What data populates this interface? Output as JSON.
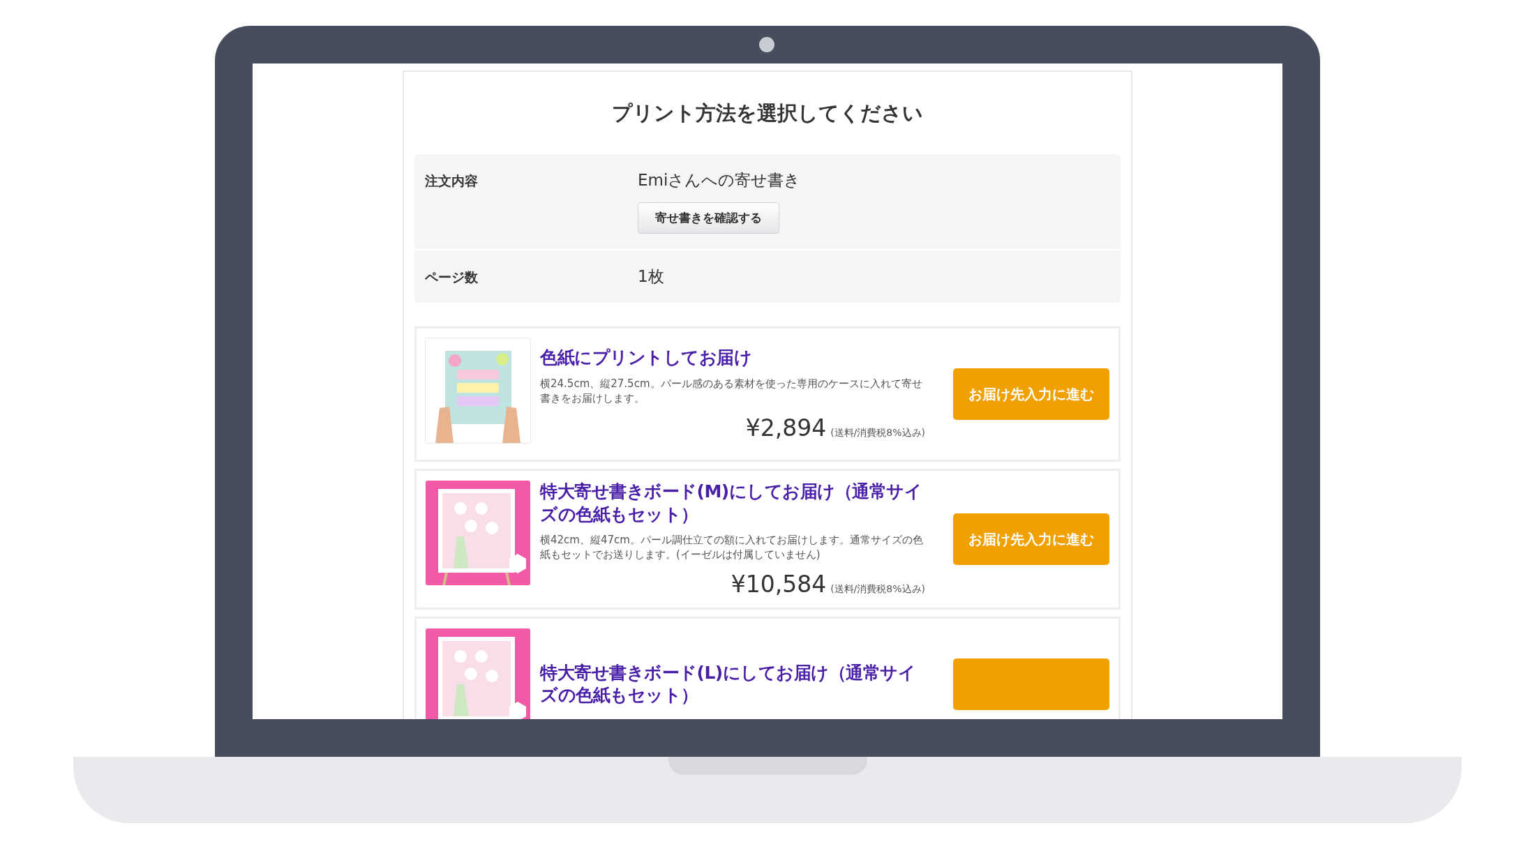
{
  "page": {
    "title": "プリント方法を選択してください"
  },
  "order_info": [
    {
      "label": "注文内容",
      "value": "Emiさんへの寄せ書き",
      "button": "寄せ書きを確認する"
    },
    {
      "label": "ページ数",
      "value": "1枚"
    }
  ],
  "options": [
    {
      "kind": "shikishi",
      "title": "色紙にプリントしてお届け",
      "description": "横24.5cm、縦27.5cm。パール感のある素材を使った専用のケースに入れて寄せ書きをお届けします。",
      "price": "¥2,894",
      "price_note": "(送料/消費税8%込み)",
      "button": {
        "label": "お届け先入力に進む"
      }
    },
    {
      "kind": "board",
      "title": "特大寄せ書きボード(M)にしてお届け（通常サイズの色紙もセット）",
      "description": "横42cm、縦47cm。パール調仕立ての額に入れてお届けします。通常サイズの色紙もセットでお送りします。(イーゼルは付属していません)",
      "price": "¥10,584",
      "price_note": "(送料/消費税8%込み)",
      "button": {
        "label": "お届け先入力に進む"
      }
    },
    {
      "kind": "board",
      "title": "特大寄せ書きボード(L)にしてお届け（通常サイズの色紙もセット）",
      "cut_button": true
    }
  ]
}
